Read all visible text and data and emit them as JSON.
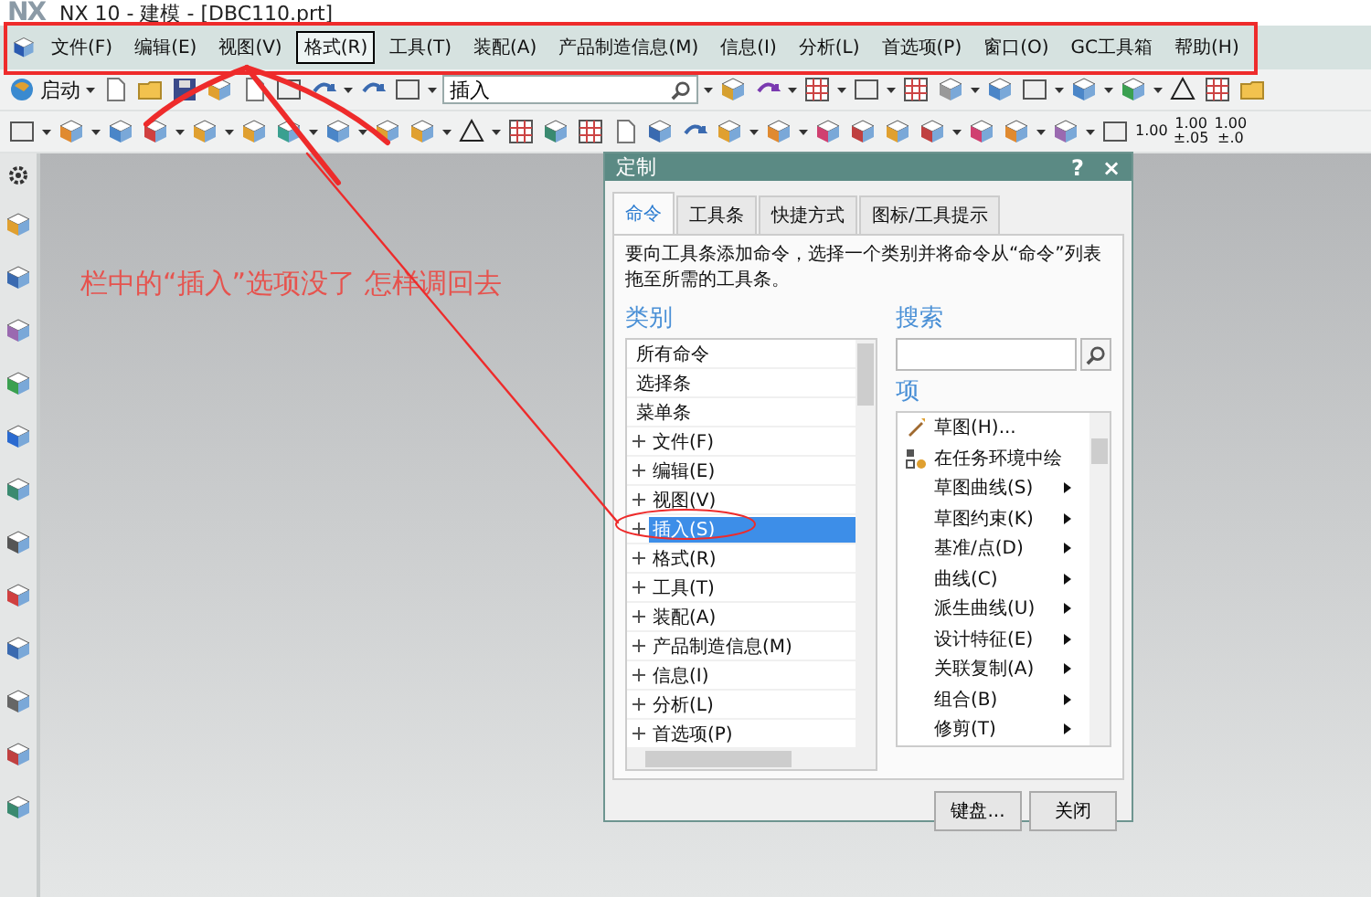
{
  "window": {
    "logo": "NX",
    "title": "NX 10 - 建模 - [DBC110.prt]"
  },
  "menu": [
    {
      "label": "文件(F)",
      "selected": false
    },
    {
      "label": "编辑(E)",
      "selected": false
    },
    {
      "label": "视图(V)",
      "selected": false
    },
    {
      "label": "格式(R)",
      "selected": true
    },
    {
      "label": "工具(T)",
      "selected": false
    },
    {
      "label": "装配(A)",
      "selected": false
    },
    {
      "label": "产品制造信息(M)",
      "selected": false
    },
    {
      "label": "信息(I)",
      "selected": false
    },
    {
      "label": "分析(L)",
      "selected": false
    },
    {
      "label": "首选项(P)",
      "selected": false
    },
    {
      "label": "窗口(O)",
      "selected": false
    },
    {
      "label": "GC工具箱",
      "selected": false
    },
    {
      "label": "帮助(H)",
      "selected": false
    }
  ],
  "toolbar": {
    "start_label": "启动",
    "command_field": {
      "value": "插入"
    },
    "dimension_styles": [
      {
        "value": "1.00"
      },
      {
        "value": "1.00",
        "tolerance": "±.05"
      },
      {
        "value": "1.00",
        "tolerance": "±.0"
      }
    ]
  },
  "annotation": {
    "text": "栏中的“插入”选项没了   怎样调回去"
  },
  "dialog": {
    "title": "定制",
    "help": "?",
    "close": "×",
    "tabs": [
      {
        "label": "命令",
        "selected": true
      },
      {
        "label": "工具条",
        "selected": false
      },
      {
        "label": "快捷方式",
        "selected": false
      },
      {
        "label": "图标/工具提示",
        "selected": false
      }
    ],
    "instruction": "要向工具条添加命令，选择一个类别并将命令从“命令”列表拖至所需的工具条。",
    "category_label": "类别",
    "categories": [
      {
        "label": "所有命令",
        "expandable": false,
        "selected": false
      },
      {
        "label": "选择条",
        "expandable": false,
        "selected": false
      },
      {
        "label": "菜单条",
        "expandable": false,
        "selected": false
      },
      {
        "label": "文件(F)",
        "expandable": true,
        "selected": false
      },
      {
        "label": "编辑(E)",
        "expandable": true,
        "selected": false
      },
      {
        "label": "视图(V)",
        "expandable": true,
        "selected": false
      },
      {
        "label": "插入(S)",
        "expandable": true,
        "selected": true
      },
      {
        "label": "格式(R)",
        "expandable": true,
        "selected": false
      },
      {
        "label": "工具(T)",
        "expandable": true,
        "selected": false
      },
      {
        "label": "装配(A)",
        "expandable": true,
        "selected": false
      },
      {
        "label": "产品制造信息(M)",
        "expandable": true,
        "selected": false
      },
      {
        "label": "信息(I)",
        "expandable": true,
        "selected": false
      },
      {
        "label": "分析(L)",
        "expandable": true,
        "selected": false
      },
      {
        "label": "首选项(P)",
        "expandable": true,
        "selected": false
      }
    ],
    "search_label": "搜索",
    "items_label": "项",
    "items": [
      {
        "label": "草图(H)...",
        "kind": "sketch",
        "submenu": false
      },
      {
        "label": "在任务环境中绘",
        "kind": "task",
        "submenu": false
      },
      {
        "label": "草图曲线(S)",
        "kind": "plain",
        "submenu": true
      },
      {
        "label": "草图约束(K)",
        "kind": "plain",
        "submenu": true
      },
      {
        "label": "基准/点(D)",
        "kind": "plain",
        "submenu": true
      },
      {
        "label": "曲线(C)",
        "kind": "plain",
        "submenu": true
      },
      {
        "label": "派生曲线(U)",
        "kind": "plain",
        "submenu": true
      },
      {
        "label": "设计特征(E)",
        "kind": "plain",
        "submenu": true
      },
      {
        "label": "关联复制(A)",
        "kind": "plain",
        "submenu": true
      },
      {
        "label": "组合(B)",
        "kind": "plain",
        "submenu": true
      },
      {
        "label": "修剪(T)",
        "kind": "plain",
        "submenu": true
      }
    ],
    "buttons": [
      "键盘...",
      "关闭"
    ]
  }
}
